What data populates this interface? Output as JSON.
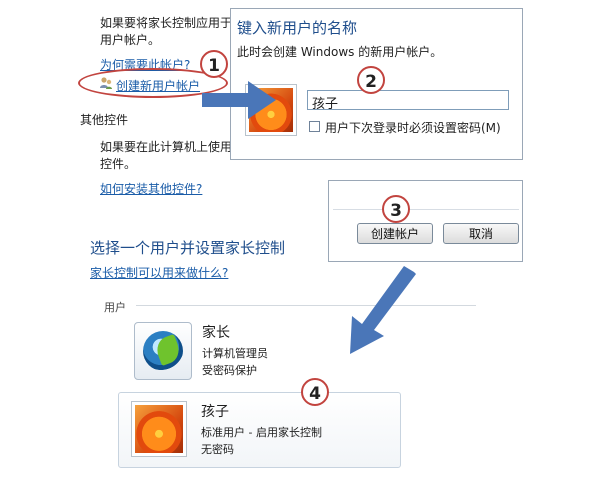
{
  "left_panel": {
    "intro_line1": "如果要将家长控制应用于",
    "intro_line2": "用户帐户。",
    "why_link": "为何需要此帐户?",
    "create_link": "创建新用户帐户",
    "other_controls_heading": "其他控件",
    "other_line1": "如果要在此计算机上使用",
    "other_line2": "控件。",
    "install_link": "如何安装其他控件?"
  },
  "new_user_dialog": {
    "title": "键入新用户的名称",
    "subtitle": "此时会创建 Windows 的新用户帐户。",
    "username_value": "孩子",
    "checkbox_label": "用户下次登录时必须设置密码(M)",
    "checkbox_checked": false
  },
  "confirm_dialog": {
    "create_button": "创建帐户",
    "cancel_button": "取消"
  },
  "select_section": {
    "heading": "选择一个用户并设置家长控制",
    "what_link": "家长控制可以用来做什么?",
    "users_label": "用户"
  },
  "users": [
    {
      "name": "家长",
      "line1": "计算机管理员",
      "line2": "受密码保护",
      "avatar": "app-logo-avatar"
    },
    {
      "name": "孩子",
      "line1": "标准用户 - 启用家长控制",
      "line2": "无密码",
      "avatar": "flower-avatar"
    }
  ],
  "steps": [
    "1",
    "2",
    "3",
    "4"
  ],
  "colors": {
    "link": "#1a5ca8",
    "badge_border": "#c2443f",
    "arrow": "#4a76b8",
    "title": "#1f4e8c"
  }
}
